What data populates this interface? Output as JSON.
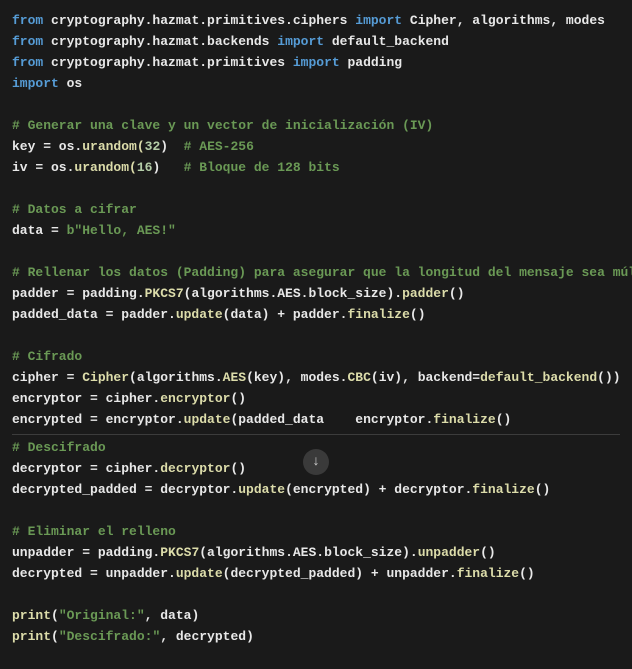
{
  "code": {
    "l1": {
      "kw1": "from",
      "mod": " cryptography.hazmat.primitives.ciphers ",
      "kw2": "import",
      "rest": " Cipher, algorithms, modes"
    },
    "l2": {
      "kw1": "from",
      "mod": " cryptography.hazmat.backends ",
      "kw2": "import",
      "rest": " default_backend"
    },
    "l3": {
      "kw1": "from",
      "mod": " cryptography.hazmat.primitives ",
      "kw2": "import",
      "rest": " padding"
    },
    "l4": {
      "kw1": "import",
      "rest": " os"
    },
    "c1": "# Generar una clave y un vector de inicialización (IV)",
    "l5": {
      "a": "key = os.",
      "fn": "urandom(",
      "n": "32",
      "b": ")",
      "cm": "  # AES-256"
    },
    "l6": {
      "a": "iv = os.",
      "fn": "urandom(",
      "n": "16",
      "b": ")",
      "cm": "   # Bloque de 128 bits"
    },
    "c2": "# Datos a cifrar",
    "l7": {
      "a": "data = ",
      "st": "b\"Hello, AES!\""
    },
    "c3": "# Rellenar los datos (Padding) para asegurar que la longitud del mensaje sea múltiplo del",
    "l8": {
      "a": "padder = padding.",
      "fn1": "PKCS7",
      "b": "(algorithms.AES.block_size).",
      "fn2": "padder",
      "c": "()"
    },
    "l9": {
      "a": "padded_data = padder.",
      "fn1": "update",
      "b": "(data) + padder.",
      "fn2": "finalize",
      "c": "()"
    },
    "c4": "# Cifrado",
    "l10": {
      "a": "cipher = ",
      "fn1": "Cipher",
      "b": "(algorithms.",
      "fn2": "AES",
      "c": "(key), modes.",
      "fn3": "CBC",
      "d": "(iv), backend=",
      "fn4": "default_backend",
      "e": "())"
    },
    "l11": {
      "a": "encryptor = cipher.",
      "fn": "encryptor",
      "b": "()"
    },
    "l12": {
      "a": "encrypted = encryptor.",
      "fn1": "update",
      "b": "(padded_data    encryptor.",
      "fn2": "finalize",
      "c": "()"
    },
    "c5": "# Descifrado",
    "l13": {
      "a": "decryptor = cipher.",
      "fn": "decryptor",
      "b": "()"
    },
    "l14": {
      "a": "decrypted_padded = decryptor.",
      "fn1": "update",
      "b": "(encrypted) + decryptor.",
      "fn2": "finalize",
      "c": "()"
    },
    "c6": "# Eliminar el relleno",
    "l15": {
      "a": "unpadder = padding.",
      "fn1": "PKCS7",
      "b": "(algorithms.AES.block_size).",
      "fn2": "unpadder",
      "c": "()"
    },
    "l16": {
      "a": "decrypted = unpadder.",
      "fn1": "update",
      "b": "(decrypted_padded) + unpadder.",
      "fn2": "finalize",
      "c": "()"
    },
    "l17": {
      "fn": "print",
      "a": "(",
      "st": "\"Original:\"",
      "b": ", data)"
    },
    "l18": {
      "fn": "print",
      "a": "(",
      "st": "\"Descifrado:\"",
      "b": ", decrypted)"
    }
  },
  "arrow": "↓"
}
